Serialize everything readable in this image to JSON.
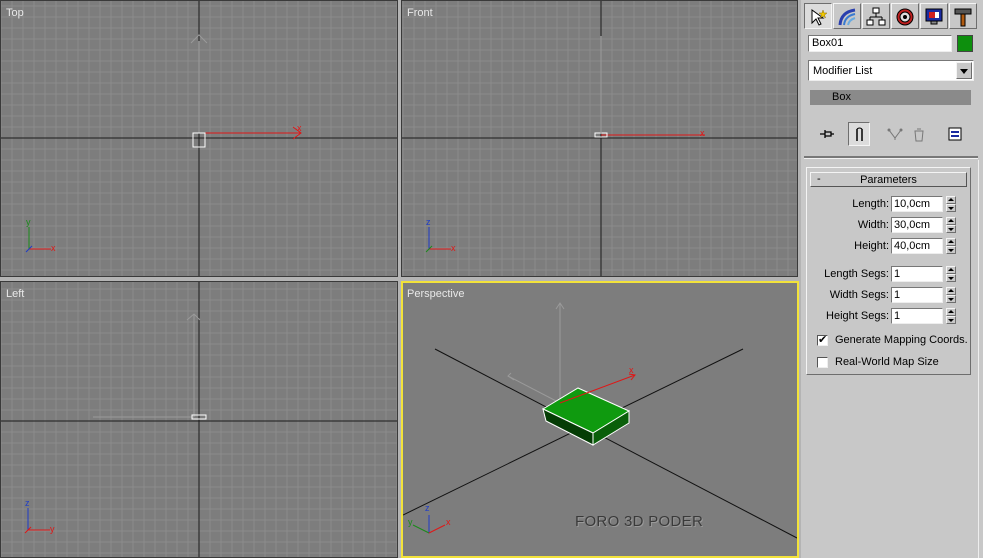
{
  "viewports": {
    "top": {
      "label": "Top"
    },
    "front": {
      "label": "Front"
    },
    "left": {
      "label": "Left"
    },
    "perspective": {
      "label": "Perspective",
      "watermark": "FORO 3D PODER"
    }
  },
  "axes": {
    "x": "x",
    "y": "y",
    "z": "z"
  },
  "colors": {
    "viewport_bg": "#7d7d7d",
    "grid": "#8e8e8e",
    "axis_line": "#1a1a1a",
    "active_border": "#f2e23a",
    "gizmo_x": "#e01616",
    "box_color": "#0d8f0d",
    "panel_bg": "#c8c8c8"
  },
  "command_panel": {
    "tabs": [
      {
        "name": "create-tab",
        "icon": "pointer-star-icon"
      },
      {
        "name": "modify-tab",
        "icon": "bend-curve-icon"
      },
      {
        "name": "hierarchy-tab",
        "icon": "hierarchy-icon"
      },
      {
        "name": "motion-tab",
        "icon": "motion-wheel-icon"
      },
      {
        "name": "display-tab",
        "icon": "display-monitor-icon"
      },
      {
        "name": "utilities-tab",
        "icon": "hammer-icon"
      }
    ],
    "object_name": "Box01",
    "object_color": "#0d8f0d",
    "modifier_list_label": "Modifier List",
    "stack_item": "Box",
    "parameters": {
      "title": "Parameters",
      "collapse_glyph": "-",
      "fields": [
        {
          "label": "Length:",
          "value": "10,0cm"
        },
        {
          "label": "Width:",
          "value": "30,0cm"
        },
        {
          "label": "Height:",
          "value": "40,0cm"
        }
      ],
      "segs": [
        {
          "label": "Length Segs:",
          "value": "1"
        },
        {
          "label": "Width Segs:",
          "value": "1"
        },
        {
          "label": "Height Segs:",
          "value": "1"
        }
      ],
      "generate_mapping": {
        "label": "Generate Mapping Coords.",
        "checked": true
      },
      "real_world": {
        "label": "Real-World Map Size",
        "checked": false
      }
    }
  }
}
